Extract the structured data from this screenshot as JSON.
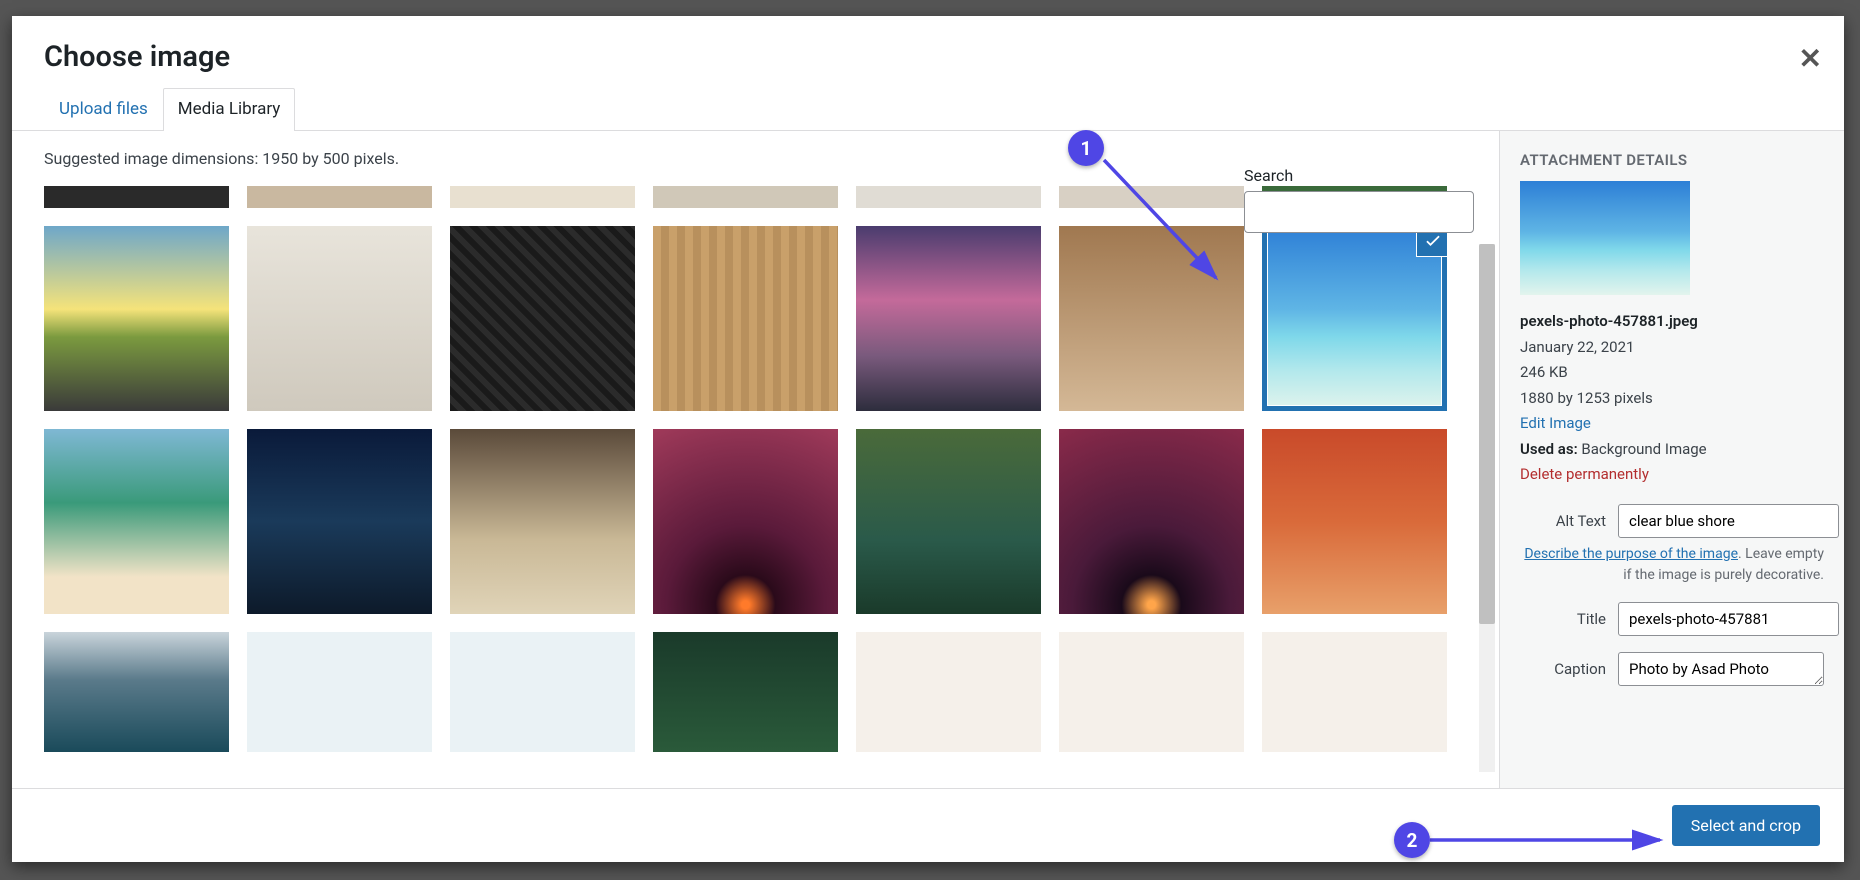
{
  "modal": {
    "title": "Choose image",
    "close_glyph": "✕"
  },
  "tabs": {
    "upload": "Upload files",
    "library": "Media Library"
  },
  "hint": "Suggested image dimensions: 1950 by 500 pixels.",
  "search": {
    "label": "Search",
    "value": ""
  },
  "sidebar": {
    "heading": "ATTACHMENT DETAILS",
    "filename": "pexels-photo-457881.jpeg",
    "date": "January 22, 2021",
    "size": "246 KB",
    "dimensions": "1880 by 1253 pixels",
    "edit_link": "Edit Image",
    "used_as_label": "Used as:",
    "used_as_value": "Background Image",
    "delete_link": "Delete permanently",
    "alt_label": "Alt Text",
    "alt_value": "clear blue shore",
    "alt_help_link": "Describe the purpose of the image",
    "alt_help_rest": ". Leave empty if the image is purely decorative.",
    "title_label": "Title",
    "title_value": "pexels-photo-457881",
    "caption_label": "Caption",
    "caption_value": "Photo by Asad Photo "
  },
  "footer": {
    "select_button": "Select and crop"
  },
  "annotations": {
    "badge1": "1",
    "badge2": "2"
  }
}
